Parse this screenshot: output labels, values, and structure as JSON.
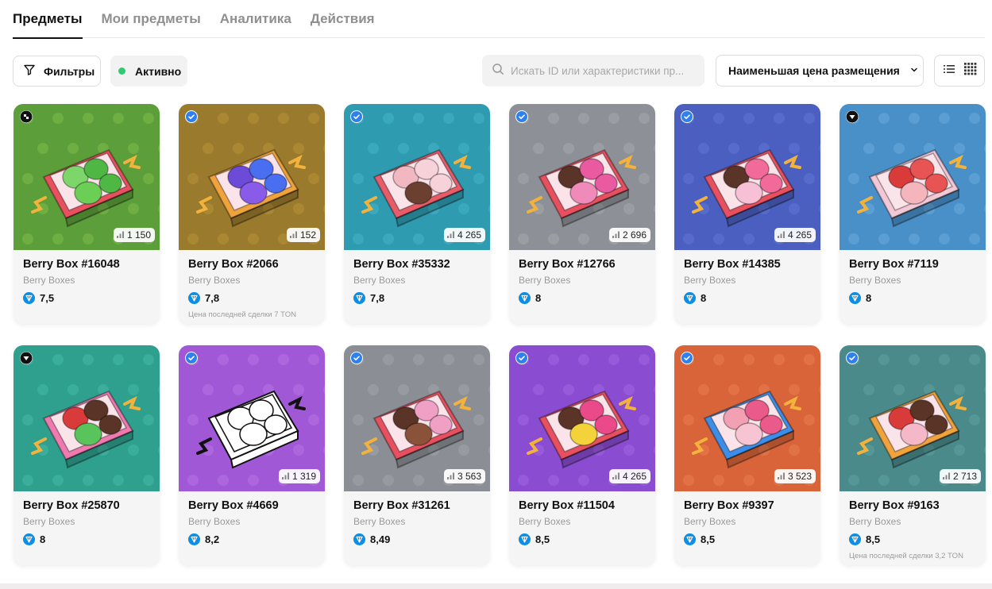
{
  "tabs": [
    {
      "label": "Предметы",
      "active": true
    },
    {
      "label": "Мои предметы",
      "active": false
    },
    {
      "label": "Аналитика",
      "active": false
    },
    {
      "label": "Действия",
      "active": false
    }
  ],
  "toolbar": {
    "filters_label": "Фильтры",
    "filters_icon": "filter-icon",
    "active_label": "Активно",
    "active_dot_color": "#2ecc71",
    "search_placeholder": "Искать ID или характеристики пр...",
    "sort_label": "Наименьшая цена размещения",
    "view_modes": [
      "list-view-icon",
      "grid-view-icon"
    ]
  },
  "colors": {
    "ton_blue": "#0a8ee8",
    "text_primary": "#111111",
    "text_muted": "#9a9a9a"
  },
  "items": [
    {
      "title": "Berry Box #16048",
      "collection": "Berry Boxes",
      "price": "7,5",
      "count": "1 150",
      "badge": "checker-icon",
      "bg": "#5c9e3a",
      "bg2": "#7fbb4a",
      "box": "#e8505f",
      "fruit": [
        "#7dd66a",
        "#4fb845",
        "#6ccf55"
      ],
      "last_sale": ""
    },
    {
      "title": "Berry Box #2066",
      "collection": "Berry Boxes",
      "price": "7,8",
      "count": "152",
      "badge": "verified-icon",
      "bg": "#9a7a2c",
      "bg2": "#b8943a",
      "box": "#f0a23c",
      "fruit": [
        "#6c4bd8",
        "#4a6ef0",
        "#8a5be8"
      ],
      "last_sale": "Цена последней сделки 7 TON"
    },
    {
      "title": "Berry Box #35332",
      "collection": "Berry Boxes",
      "price": "7,8",
      "count": "4 265",
      "badge": "verified-icon",
      "bg": "#2e9bb0",
      "bg2": "#45b4c8",
      "box": "#e85c6a",
      "fruit": [
        "#f2b8c2",
        "#f7d2d8",
        "#6b4030"
      ],
      "last_sale": ""
    },
    {
      "title": "Berry Box #12766",
      "collection": "Berry Boxes",
      "price": "8",
      "count": "2 696",
      "badge": "verified-icon",
      "bg": "#8d9096",
      "bg2": "#a6a9ae",
      "box": "#e8505f",
      "fruit": [
        "#5a3426",
        "#ea5aa0",
        "#f08ab8"
      ],
      "last_sale": ""
    },
    {
      "title": "Berry Box #14385",
      "collection": "Berry Boxes",
      "price": "8",
      "count": "4 265",
      "badge": "verified-icon",
      "bg": "#4b5fc0",
      "bg2": "#6275d6",
      "box": "#e8505f",
      "fruit": [
        "#5a3426",
        "#f26a9a",
        "#f7c0d4"
      ],
      "last_sale": ""
    },
    {
      "title": "Berry Box #7119",
      "collection": "Berry Boxes",
      "price": "8",
      "count": "",
      "badge": "shield-icon",
      "bg": "#4a90c8",
      "bg2": "#67a9dc",
      "box": "#f2c8d6",
      "fruit": [
        "#d93a3a",
        "#e85454",
        "#f4b5bd"
      ],
      "last_sale": ""
    },
    {
      "title": "Berry Box #25870",
      "collection": "Berry Boxes",
      "price": "8",
      "count": "",
      "badge": "shield-icon",
      "bg": "#2fa08e",
      "bg2": "#46b8a6",
      "box": "#f07ab0",
      "fruit": [
        "#d93a3a",
        "#5a3426",
        "#59c45c"
      ],
      "last_sale": ""
    },
    {
      "title": "Berry Box #4669",
      "collection": "Berry Boxes",
      "price": "8,2",
      "count": "1 319",
      "badge": "verified-icon",
      "bg": "#a158d6",
      "bg2": "#b874e6",
      "box": "#ffffff",
      "fruit": [
        "#ffffff",
        "#ffffff",
        "#ffffff"
      ],
      "last_sale": ""
    },
    {
      "title": "Berry Box #31261",
      "collection": "Berry Boxes",
      "price": "8,49",
      "count": "3 563",
      "badge": "verified-icon",
      "bg": "#8b8f95",
      "bg2": "#a2a6ab",
      "box": "#e8505f",
      "fruit": [
        "#5a3426",
        "#f0a0c4",
        "#8a5238"
      ],
      "last_sale": ""
    },
    {
      "title": "Berry Box #11504",
      "collection": "Berry Boxes",
      "price": "8,5",
      "count": "4 265",
      "badge": "verified-icon",
      "bg": "#8a4cd0",
      "bg2": "#a066e2",
      "box": "#e8505f",
      "fruit": [
        "#5a3426",
        "#ea4a8a",
        "#f4d23a"
      ],
      "last_sale": ""
    },
    {
      "title": "Berry Box #9397",
      "collection": "Berry Boxes",
      "price": "8,5",
      "count": "3 523",
      "badge": "verified-icon",
      "bg": "#d9643a",
      "bg2": "#ea7d50",
      "box": "#3d8ee8",
      "fruit": [
        "#f2a0b4",
        "#ea5a8a",
        "#f6c4d2"
      ],
      "last_sale": ""
    },
    {
      "title": "Berry Box #9163",
      "collection": "Berry Boxes",
      "price": "8,5",
      "count": "2 713",
      "badge": "verified-icon",
      "bg": "#4a8a8a",
      "bg2": "#5fa1a0",
      "box": "#f0a23c",
      "fruit": [
        "#d93a3a",
        "#5a3426",
        "#f4b8c8"
      ],
      "last_sale": "Цена последней сделки 3,2 TON"
    }
  ]
}
